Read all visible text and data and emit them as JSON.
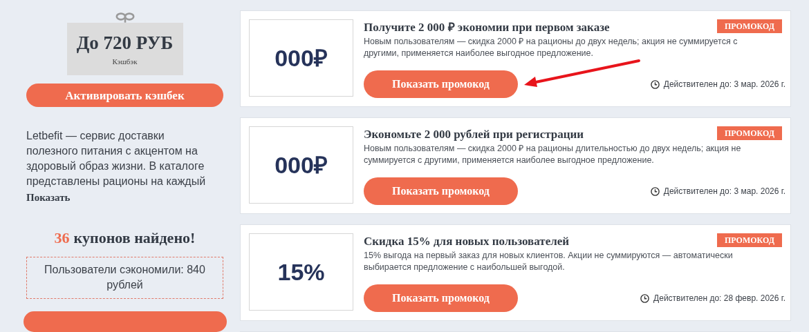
{
  "cashback": {
    "amount": "До 720 РУБ",
    "label": "Кэшбэк",
    "button": "Активировать кэшбек"
  },
  "description": {
    "text": "Letbefit — сервис доставки полезного питания с акцентом на здоровый образ жизни. В каталоге представлены рационы на каждый",
    "more": "Показать"
  },
  "found": {
    "count": "36",
    "text": "купонов найдено!"
  },
  "saved": "Пользователи сэкономили: 840 рублей",
  "coupons": [
    {
      "value": "000₽",
      "title": "Получите 2 000 ₽ экономии при первом заказе",
      "description": "Новым пользователям — скидка 2000 ₽ на рационы до двух недель; акция не суммируется с другими, применяется наиболее выгодное предложение.",
      "badge": "ПРОМОКОД",
      "button": "Показать промокод",
      "expires": "Действителен до: 3 мар. 2026 г.",
      "arrow": true
    },
    {
      "value": "000₽",
      "title": "Экономьте 2 000 рублей при регистрации",
      "description": "Новым пользователям — скидка 2000 ₽ на рационы длительностью до двух недель; акция не суммируется с другими, применяется наиболее выгодное предложение.",
      "badge": "ПРОМОКОД",
      "button": "Показать промокод",
      "expires": "Действителен до: 3 мар. 2026 г.",
      "arrow": false
    },
    {
      "value": "15%",
      "title": "Скидка 15% для новых пользователей",
      "description": "15% выгода на первый заказ для новых клиентов. Акции не суммируются — автоматически выбирается предложение с наибольшей выгодой.",
      "badge": "ПРОМОКОД",
      "button": "Показать промокод",
      "expires": "Действителен до: 28 февр. 2026 г.",
      "arrow": false
    }
  ]
}
